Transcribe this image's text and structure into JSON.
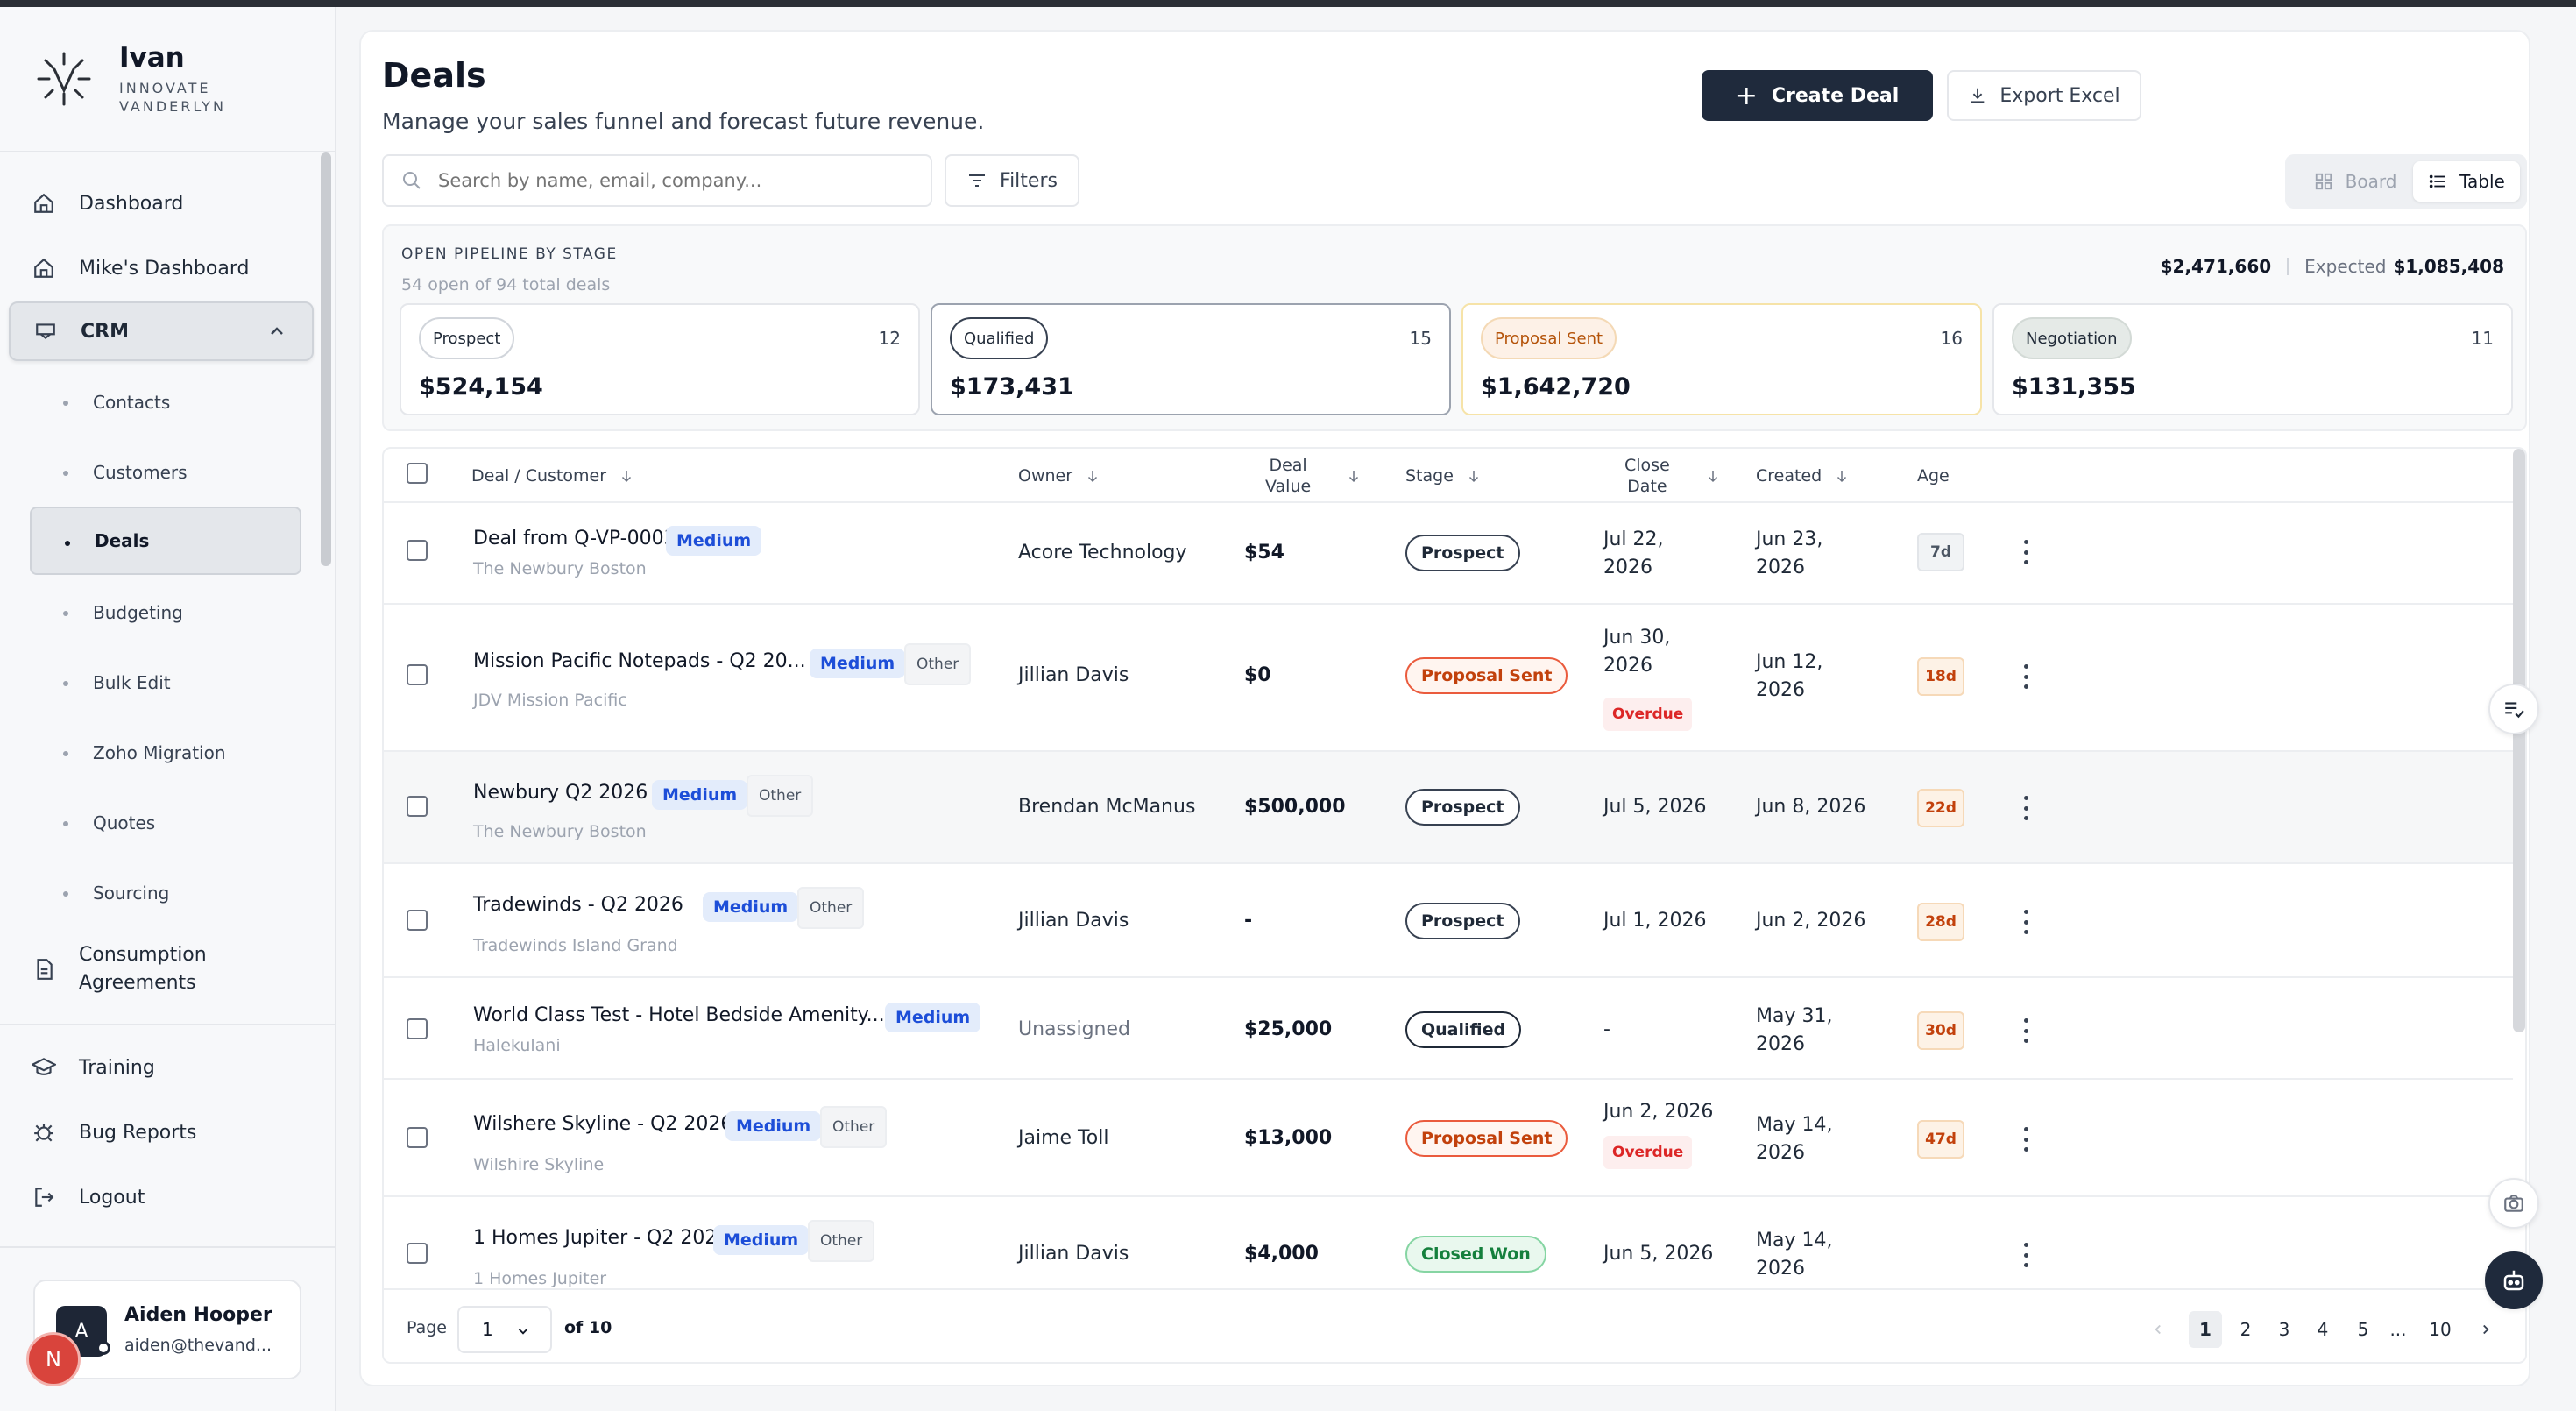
{
  "brand": {
    "name": "Ivan",
    "sub_line1": "INNOVATE",
    "sub_line2": "VANDERLYN"
  },
  "sidebar": {
    "items": [
      {
        "label": "Dashboard",
        "icon": "home-icon"
      },
      {
        "label": "Mike's Dashboard",
        "icon": "home-icon"
      },
      {
        "label": "CRM",
        "icon": "crm-icon",
        "expanded": true
      },
      {
        "label": "Consumption Agreements",
        "icon": "document-icon"
      },
      {
        "label": "Training",
        "icon": "graduation-icon"
      },
      {
        "label": "Bug Reports",
        "icon": "bug-icon"
      },
      {
        "label": "Logout",
        "icon": "logout-icon"
      }
    ],
    "crm_sub": [
      "Contacts",
      "Customers",
      "Deals",
      "Budgeting",
      "Bulk Edit",
      "Zoho Migration",
      "Quotes",
      "Sourcing"
    ],
    "consumption_line1": "Consumption",
    "consumption_line2": "Agreements"
  },
  "user": {
    "initial": "A",
    "name": "Aiden Hooper",
    "email": "aiden@thevand...",
    "notif_initial": "N"
  },
  "page": {
    "title": "Deals",
    "subtitle": "Manage your sales funnel and forecast future revenue.",
    "create_label": "Create Deal",
    "export_label": "Export Excel",
    "search_placeholder": "Search by name, email, company...",
    "filters_label": "Filters",
    "view_board": "Board",
    "view_table": "Table"
  },
  "pipeline": {
    "title": "OPEN PIPELINE BY STAGE",
    "subtitle": "54 open of 94 total deals",
    "total": "$2,471,660",
    "expected_label": "Expected",
    "expected_value": "$1,085,408",
    "stages": [
      {
        "name": "Prospect",
        "count": "12",
        "amount": "$524,154"
      },
      {
        "name": "Qualified",
        "count": "15",
        "amount": "$173,431"
      },
      {
        "name": "Proposal Sent",
        "count": "16",
        "amount": "$1,642,720"
      },
      {
        "name": "Negotiation",
        "count": "11",
        "amount": "$131,355"
      }
    ]
  },
  "table": {
    "headers": {
      "deal": "Deal / Customer",
      "owner": "Owner",
      "value_l1": "Deal",
      "value_l2": "Value",
      "stage": "Stage",
      "close_l1": "Close",
      "close_l2": "Date",
      "created": "Created",
      "age": "Age"
    },
    "rows": [
      {
        "name": "Deal from Q-VP-0003",
        "priority": "Medium",
        "tag": "",
        "customer": "The Newbury Boston",
        "owner": "Acore Technology",
        "value": "$54",
        "stage": "Prospect",
        "close_l1": "Jul 22,",
        "close_l2": "2026",
        "overdue": "",
        "created_l1": "Jun 23,",
        "created_l2": "2026",
        "age": "7d"
      },
      {
        "name": "Mission Pacific Notepads - Q2 20...",
        "priority": "Medium",
        "tag": "Other",
        "customer": "JDV Mission Pacific",
        "owner": "Jillian Davis",
        "value": "$0",
        "stage": "Proposal Sent",
        "close_l1": "Jun 30,",
        "close_l2": "2026",
        "overdue": "Overdue",
        "created_l1": "Jun 12,",
        "created_l2": "2026",
        "age": "18d"
      },
      {
        "name": "Newbury Q2 2026",
        "priority": "Medium",
        "tag": "Other",
        "customer": "The Newbury Boston",
        "owner": "Brendan McManus",
        "value": "$500,000",
        "stage": "Prospect",
        "close_l1": "Jul 5, 2026",
        "close_l2": "",
        "overdue": "",
        "created_l1": "Jun 8, 2026",
        "created_l2": "",
        "age": "22d"
      },
      {
        "name": "Tradewinds - Q2 2026",
        "priority": "Medium",
        "tag": "Other",
        "customer": "Tradewinds Island Grand",
        "owner": "Jillian Davis",
        "value": "-",
        "stage": "Prospect",
        "close_l1": "Jul 1, 2026",
        "close_l2": "",
        "overdue": "",
        "created_l1": "Jun 2, 2026",
        "created_l2": "",
        "age": "28d"
      },
      {
        "name": "World Class Test - Hotel Bedside Amenity...",
        "priority": "Medium",
        "tag": "",
        "customer": "Halekulani",
        "owner": "Unassigned",
        "value": "$25,000",
        "stage": "Qualified",
        "close_l1": "-",
        "close_l2": "",
        "overdue": "",
        "created_l1": "May 31,",
        "created_l2": "2026",
        "age": "30d"
      },
      {
        "name": "Wilshere Skyline - Q2 2026",
        "priority": "Medium",
        "tag": "Other",
        "customer": "Wilshire Skyline",
        "owner": "Jaime Toll",
        "value": "$13,000",
        "stage": "Proposal Sent",
        "close_l1": "Jun 2, 2026",
        "close_l2": "",
        "overdue": "Overdue",
        "created_l1": "May 14,",
        "created_l2": "2026",
        "age": "47d"
      },
      {
        "name": "1 Homes Jupiter - Q2 2026",
        "priority": "Medium",
        "tag": "Other",
        "customer": "1 Homes Jupiter",
        "owner": "Jillian Davis",
        "value": "$4,000",
        "stage": "Closed Won",
        "close_l1": "Jun 5, 2026",
        "close_l2": "",
        "overdue": "",
        "created_l1": "May 14,",
        "created_l2": "2026",
        "age": ""
      }
    ]
  },
  "pagination": {
    "page_label": "Page",
    "current": "1",
    "of_label": "of 10",
    "pages": [
      "1",
      "2",
      "3",
      "4",
      "5",
      "...",
      "10"
    ]
  }
}
